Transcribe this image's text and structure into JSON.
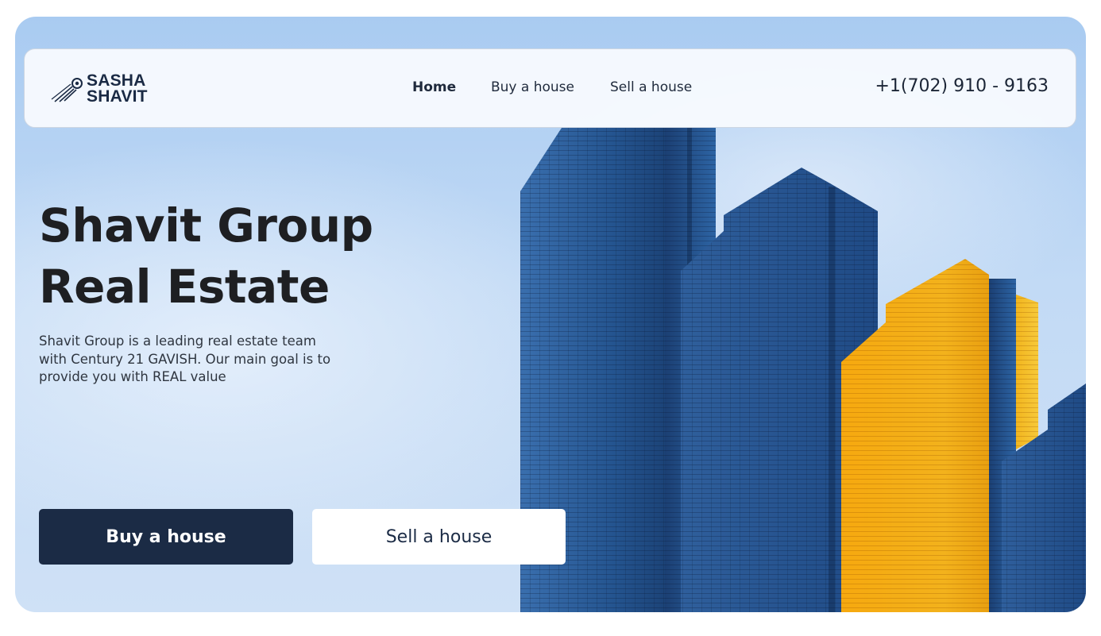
{
  "brand": {
    "line1": "SASHA",
    "line2": "SHAVIT"
  },
  "nav": {
    "items": [
      {
        "label": "Home",
        "active": true
      },
      {
        "label": "Buy a house",
        "active": false
      },
      {
        "label": "Sell a house",
        "active": false
      }
    ],
    "phone": "+1(702) 910 - 9163"
  },
  "hero": {
    "title_line1": "Shavit Group",
    "title_line2": "Real Estate",
    "description": "Shavit Group is a leading real estate team with Century 21 GAVISH. Our main goal is to provide you with REAL value",
    "primary_button": "Buy a house",
    "secondary_button": "Sell a house"
  },
  "colors": {
    "navy": "#1b2b45",
    "sky": "#b9d4f3",
    "building_blue": "#2d5f9e",
    "building_yellow": "#f5b417"
  }
}
